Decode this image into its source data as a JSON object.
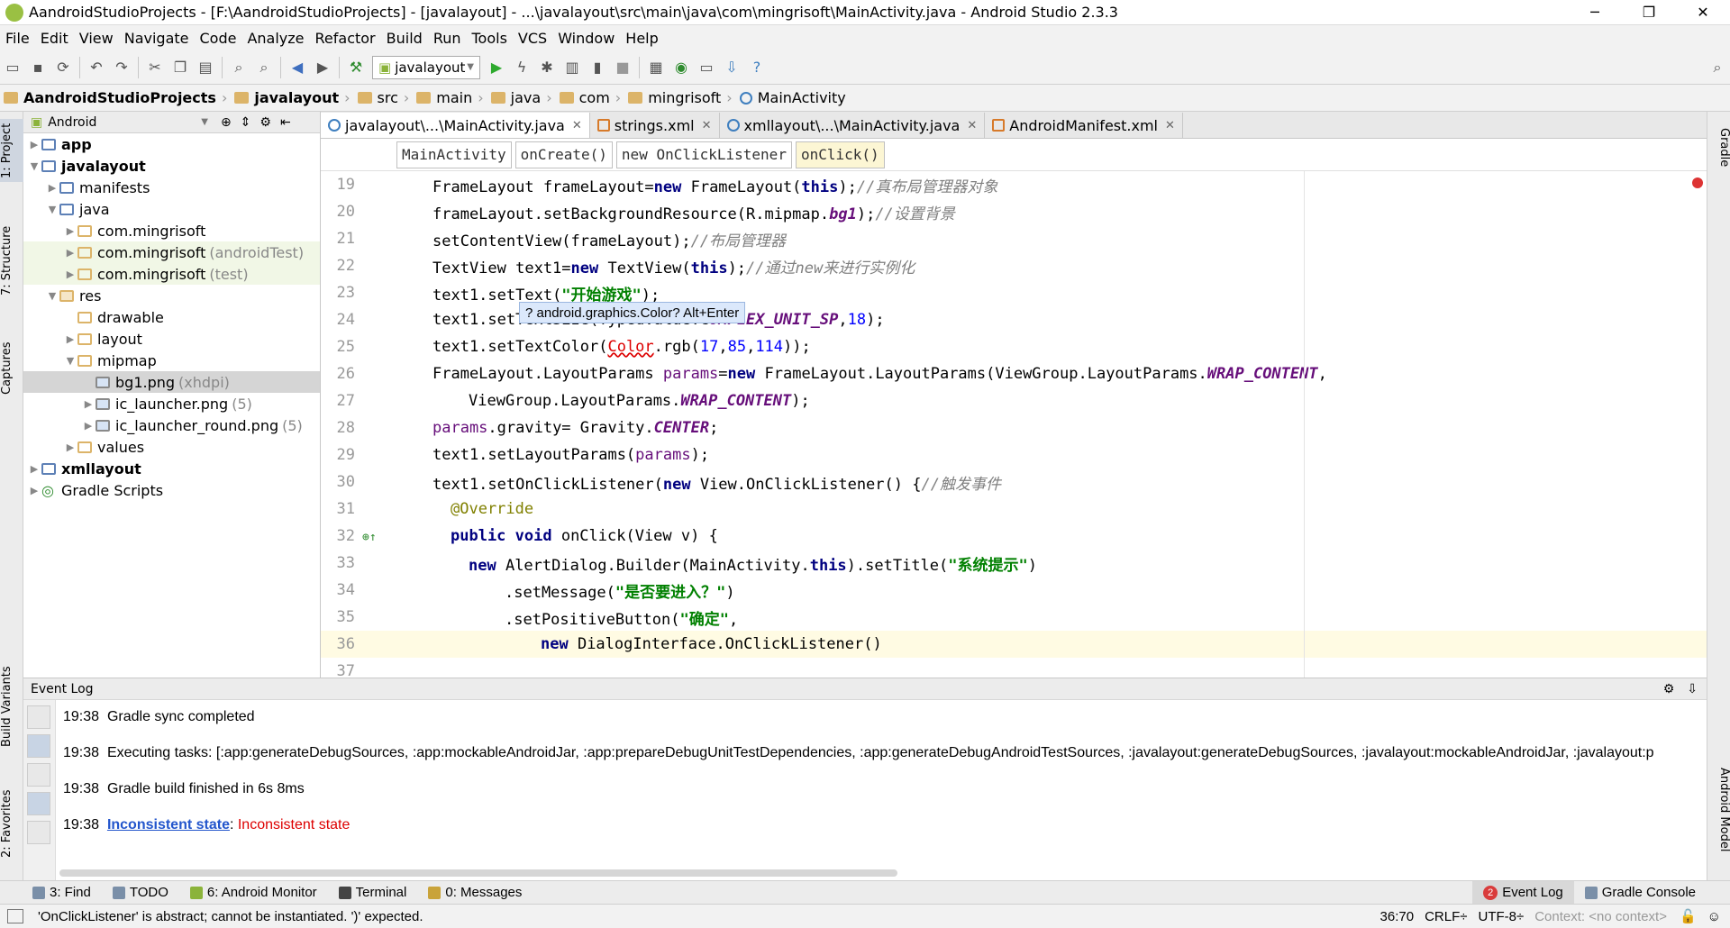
{
  "window": {
    "title": "AandroidStudioProjects - [F:\\AandroidStudioProjects] - [javalayout] - ...\\javalayout\\src\\main\\java\\com\\mingrisoft\\MainActivity.java - Android Studio 2.3.3",
    "minimize": "─",
    "maximize": "❐",
    "close": "✕"
  },
  "menu": [
    "File",
    "Edit",
    "View",
    "Navigate",
    "Code",
    "Analyze",
    "Refactor",
    "Build",
    "Run",
    "Tools",
    "VCS",
    "Window",
    "Help"
  ],
  "toolbar": {
    "run_config": "javalayout"
  },
  "nav": [
    "AandroidStudioProjects",
    "javalayout",
    "src",
    "main",
    "java",
    "com",
    "mingrisoft",
    "MainActivity"
  ],
  "project": {
    "view": "Android",
    "tree": [
      {
        "label": "app",
        "depth": 0,
        "open": false,
        "icon": "folder",
        "bold": true,
        "hint": ""
      },
      {
        "label": "javalayout",
        "depth": 0,
        "open": true,
        "icon": "folder",
        "bold": true,
        "hint": ""
      },
      {
        "label": "manifests",
        "depth": 1,
        "open": false,
        "icon": "folder",
        "bold": false,
        "hint": ""
      },
      {
        "label": "java",
        "depth": 1,
        "open": true,
        "icon": "folder",
        "bold": false,
        "hint": ""
      },
      {
        "label": "com.mingrisoft",
        "depth": 2,
        "open": false,
        "icon": "pkg",
        "bold": false,
        "hint": ""
      },
      {
        "label": "com.mingrisoft",
        "depth": 2,
        "open": false,
        "icon": "pkg",
        "bold": false,
        "hint": "(androidTest)"
      },
      {
        "label": "com.mingrisoft",
        "depth": 2,
        "open": false,
        "icon": "pkg",
        "bold": false,
        "hint": "(test)"
      },
      {
        "label": "res",
        "depth": 1,
        "open": true,
        "icon": "res",
        "bold": false,
        "hint": ""
      },
      {
        "label": "drawable",
        "depth": 2,
        "open": null,
        "icon": "pkg",
        "bold": false,
        "hint": ""
      },
      {
        "label": "layout",
        "depth": 2,
        "open": false,
        "icon": "pkg",
        "bold": false,
        "hint": ""
      },
      {
        "label": "mipmap",
        "depth": 2,
        "open": true,
        "icon": "pkg",
        "bold": false,
        "hint": ""
      },
      {
        "label": "bg1.png",
        "depth": 3,
        "open": null,
        "icon": "img",
        "bold": false,
        "hint": "(xhdpi)",
        "selected": true
      },
      {
        "label": "ic_launcher.png",
        "depth": 3,
        "open": false,
        "icon": "img",
        "bold": false,
        "hint": "(5)"
      },
      {
        "label": "ic_launcher_round.png",
        "depth": 3,
        "open": false,
        "icon": "img",
        "bold": false,
        "hint": "(5)"
      },
      {
        "label": "values",
        "depth": 2,
        "open": false,
        "icon": "pkg",
        "bold": false,
        "hint": ""
      },
      {
        "label": "xmllayout",
        "depth": 0,
        "open": false,
        "icon": "folder",
        "bold": true,
        "hint": ""
      },
      {
        "label": "Gradle Scripts",
        "depth": 0,
        "open": false,
        "icon": "gradle",
        "bold": false,
        "hint": ""
      }
    ]
  },
  "tabs": [
    {
      "label": "javalayout\\...\\MainActivity.java",
      "active": true
    },
    {
      "label": "strings.xml",
      "active": false
    },
    {
      "label": "xmllayout\\...\\MainActivity.java",
      "active": false
    },
    {
      "label": "AndroidManifest.xml",
      "active": false
    }
  ],
  "code_breadcrumbs": [
    "MainActivity",
    "onCreate()",
    "new OnClickListener",
    "onClick()"
  ],
  "code": [
    {
      "n": "19",
      "indent": 4,
      "toks": [
        [
          "p",
          "FrameLayout frameLayout="
        ],
        [
          "kw",
          "new"
        ],
        [
          "p",
          " FrameLayout("
        ],
        [
          "kw",
          "this"
        ],
        [
          "p",
          ");"
        ],
        [
          "cm",
          "//真布局管理器对象"
        ]
      ]
    },
    {
      "n": "20",
      "indent": 4,
      "toks": [
        [
          "p",
          "frameLayout.setBackgroundResource(R.mipmap."
        ],
        [
          "sf",
          "bg1"
        ],
        [
          "p",
          ");"
        ],
        [
          "cm",
          "//设置背景"
        ]
      ]
    },
    {
      "n": "21",
      "indent": 4,
      "toks": [
        [
          "p",
          "setContentView(frameLayout);"
        ],
        [
          "cm",
          "//布局管理器"
        ]
      ]
    },
    {
      "n": "22",
      "indent": 4,
      "toks": [
        [
          "p",
          "TextView text1="
        ],
        [
          "kw",
          "new"
        ],
        [
          "p",
          " TextView("
        ],
        [
          "kw",
          "this"
        ],
        [
          "p",
          ");"
        ],
        [
          "cm",
          "//通过new来进行实例化"
        ]
      ]
    },
    {
      "n": "23",
      "indent": 4,
      "toks": [
        [
          "p",
          "text1.setText("
        ],
        [
          "st",
          "\"开始游戏\""
        ],
        [
          "p",
          ");"
        ]
      ]
    },
    {
      "n": "24",
      "indent": 4,
      "toks": [
        [
          "p",
          "text1.setTextSize(TypedValue.C"
        ],
        [
          "sf",
          "OMPLEX_UNIT_SP"
        ],
        [
          "p",
          ","
        ],
        [
          "num",
          "18"
        ],
        [
          "p",
          ");"
        ]
      ]
    },
    {
      "n": "25",
      "indent": 4,
      "toks": [
        [
          "p",
          "text1.setTextColor("
        ],
        [
          "err",
          "Color"
        ],
        [
          "p",
          ".rgb("
        ],
        [
          "num",
          "17"
        ],
        [
          "p",
          ","
        ],
        [
          "num",
          "85"
        ],
        [
          "p",
          ","
        ],
        [
          "num",
          "114"
        ],
        [
          "p",
          "));"
        ]
      ]
    },
    {
      "n": "26",
      "indent": 4,
      "toks": [
        [
          "p",
          "FrameLayout.LayoutParams "
        ],
        [
          "fd",
          "params"
        ],
        [
          "p",
          "="
        ],
        [
          "kw",
          "new"
        ],
        [
          "p",
          " FrameLayout.LayoutParams(ViewGroup.LayoutParams."
        ],
        [
          "sf",
          "WRAP_CONTENT"
        ],
        [
          "p",
          ","
        ]
      ]
    },
    {
      "n": "27",
      "indent": 8,
      "toks": [
        [
          "p",
          "ViewGroup.LayoutParams."
        ],
        [
          "sf",
          "WRAP_CONTENT"
        ],
        [
          "p",
          ");"
        ]
      ]
    },
    {
      "n": "28",
      "indent": 4,
      "toks": [
        [
          "fd",
          "params"
        ],
        [
          "p",
          ".gravity= Gravity."
        ],
        [
          "sf",
          "CENTER"
        ],
        [
          "p",
          ";"
        ]
      ]
    },
    {
      "n": "29",
      "indent": 4,
      "toks": [
        [
          "p",
          "text1.setLayoutParams("
        ],
        [
          "fd",
          "params"
        ],
        [
          "p",
          ");"
        ]
      ]
    },
    {
      "n": "30",
      "indent": 4,
      "toks": [
        [
          "p",
          "text1.setOnClickListener("
        ],
        [
          "kw",
          "new"
        ],
        [
          "p",
          " View.OnClickListener() {"
        ],
        [
          "cm",
          "//触发事件"
        ]
      ]
    },
    {
      "n": "31",
      "indent": 6,
      "toks": [
        [
          "an",
          "@Override"
        ]
      ]
    },
    {
      "n": "32",
      "indent": 6,
      "toks": [
        [
          "kw",
          "public void"
        ],
        [
          "p",
          " onClick(View v) {"
        ]
      ]
    },
    {
      "n": "33",
      "indent": 8,
      "toks": [
        [
          "kw",
          "new"
        ],
        [
          "p",
          " AlertDialog.Builder(MainActivity."
        ],
        [
          "kw",
          "this"
        ],
        [
          "p",
          ").setTitle("
        ],
        [
          "st",
          "\"系统提示\""
        ],
        [
          "p",
          ")"
        ]
      ]
    },
    {
      "n": "34",
      "indent": 12,
      "toks": [
        [
          "p",
          ".setMessage("
        ],
        [
          "st",
          "\"是否要进入？\""
        ],
        [
          "p",
          ")"
        ]
      ]
    },
    {
      "n": "35",
      "indent": 12,
      "toks": [
        [
          "p",
          ".setPositiveButton("
        ],
        [
          "st",
          "\"确定\""
        ],
        [
          "p",
          ","
        ]
      ]
    },
    {
      "n": "36",
      "indent": 16,
      "toks": [
        [
          "kw",
          "new"
        ],
        [
          "p",
          " DialogInterface.OnClickListener()"
        ]
      ],
      "current": true
    },
    {
      "n": "37",
      "indent": 0,
      "toks": []
    }
  ],
  "popup": "? android.graphics.Color? Alt+Enter",
  "event_log": {
    "title": "Event Log",
    "entries": [
      {
        "time": "19:38",
        "text": "Gradle sync completed"
      },
      {
        "time": "19:38",
        "text": "Executing tasks: [:app:generateDebugSources, :app:mockableAndroidJar, :app:prepareDebugUnitTestDependencies, :app:generateDebugAndroidTestSources, :javalayout:generateDebugSources, :javalayout:mockableAndroidJar, :javalayout:p"
      },
      {
        "time": "19:38",
        "text": "Gradle build finished in 6s 8ms"
      },
      {
        "time": "19:38",
        "link": "Inconsistent state",
        "err": "Inconsistent state"
      }
    ]
  },
  "bottom_tools": [
    {
      "label": "3: Find"
    },
    {
      "label": "TODO"
    },
    {
      "label": "6: Android Monitor"
    },
    {
      "label": "Terminal"
    },
    {
      "label": "0: Messages"
    }
  ],
  "bottom_right": [
    {
      "label": "Event Log",
      "badge": "2"
    },
    {
      "label": "Gradle Console"
    }
  ],
  "left_strip": [
    "1: Project",
    "7: Structure",
    "Captures",
    "Build Variants",
    "2: Favorites"
  ],
  "right_strip": [
    "Gradle",
    "Android Model"
  ],
  "status": {
    "message": "'OnClickListener' is abstract; cannot be instantiated. ')' expected.",
    "position": "36:70",
    "line_sep": "CRLF÷",
    "encoding": "UTF-8÷",
    "context": "Context: <no context>"
  }
}
